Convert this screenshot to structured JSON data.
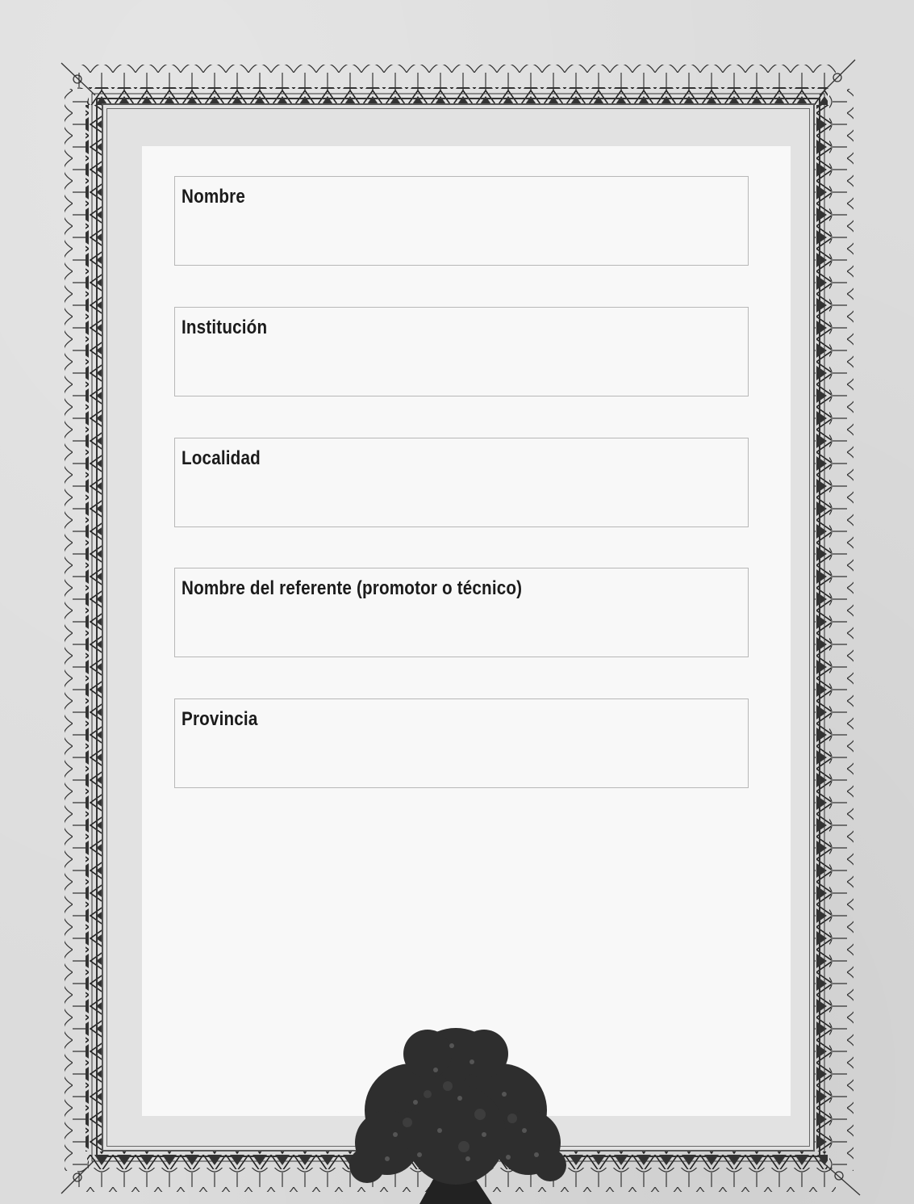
{
  "form": {
    "fields": [
      {
        "label": "Nombre",
        "value": ""
      },
      {
        "label": "Institución",
        "value": ""
      },
      {
        "label": "Localidad",
        "value": ""
      },
      {
        "label": "Nombre del referente (promotor o técnico)",
        "value": ""
      },
      {
        "label": "Provincia",
        "value": ""
      }
    ]
  },
  "decoration": {
    "frame": "ornamental-certificate-border-icon",
    "illustration": "tree-icon",
    "colors": {
      "paper": "#dcdcdc",
      "sheet": "#f8f8f8",
      "ink": "#1b1b1b",
      "field_border": "#b8b8b8"
    }
  }
}
